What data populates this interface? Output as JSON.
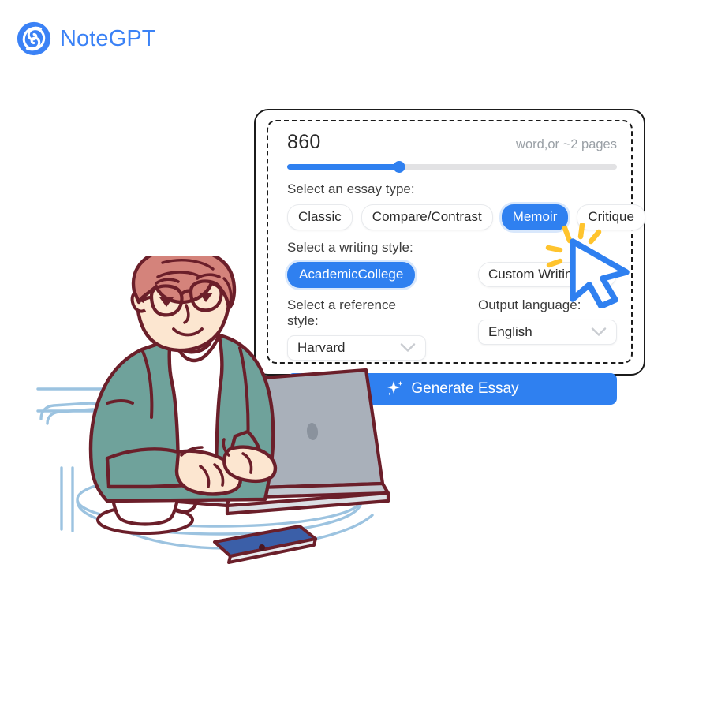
{
  "brand": {
    "name": "NoteGPT",
    "logo_icon": "spiral-logo-icon",
    "color": "#3B82F6"
  },
  "theme": {
    "accent": "#2F80F0",
    "text": "#2b2b2b",
    "muted": "#9aa0a6",
    "border": "#e8eaed"
  },
  "panel": {
    "word_count": {
      "value": "860",
      "note": "word,or ~2 pages",
      "slider_percent": 34
    },
    "essay_type": {
      "label": "Select an essay type:",
      "options": [
        {
          "label": "Classic",
          "selected": false
        },
        {
          "label": "Compare/Contrast",
          "selected": false
        },
        {
          "label": "Memoir",
          "selected": true
        },
        {
          "label": "Critique",
          "selected": false
        }
      ]
    },
    "writing_style": {
      "label": "Select a writing style:",
      "value": "AcademicCollege"
    },
    "custom_writing": {
      "value": "Custom Writing"
    },
    "reference_style": {
      "label": "Select a reference style:",
      "value": "Harvard",
      "caret_icon": "chevron-down-icon"
    },
    "output_language": {
      "label": "Output language:",
      "value": "English",
      "caret_icon": "chevron-down-icon"
    },
    "generate": {
      "label": "Generate Essay",
      "icon": "sparkle-icon"
    }
  },
  "cursor": {
    "icon": "mouse-pointer-click-icon",
    "color": "#2F80F0",
    "burst_color": "#FFC42E"
  },
  "illustration": {
    "name": "man-typing-on-laptop-illustration",
    "colors": {
      "outline": "#6B1F2A",
      "shirt": "#6FA29B",
      "skin": "#FCE6D0",
      "hair": "#D4837B",
      "laptop": "#A9B0BA",
      "furniture": "#9CC3E0",
      "phone": "#3B5FA8"
    }
  }
}
